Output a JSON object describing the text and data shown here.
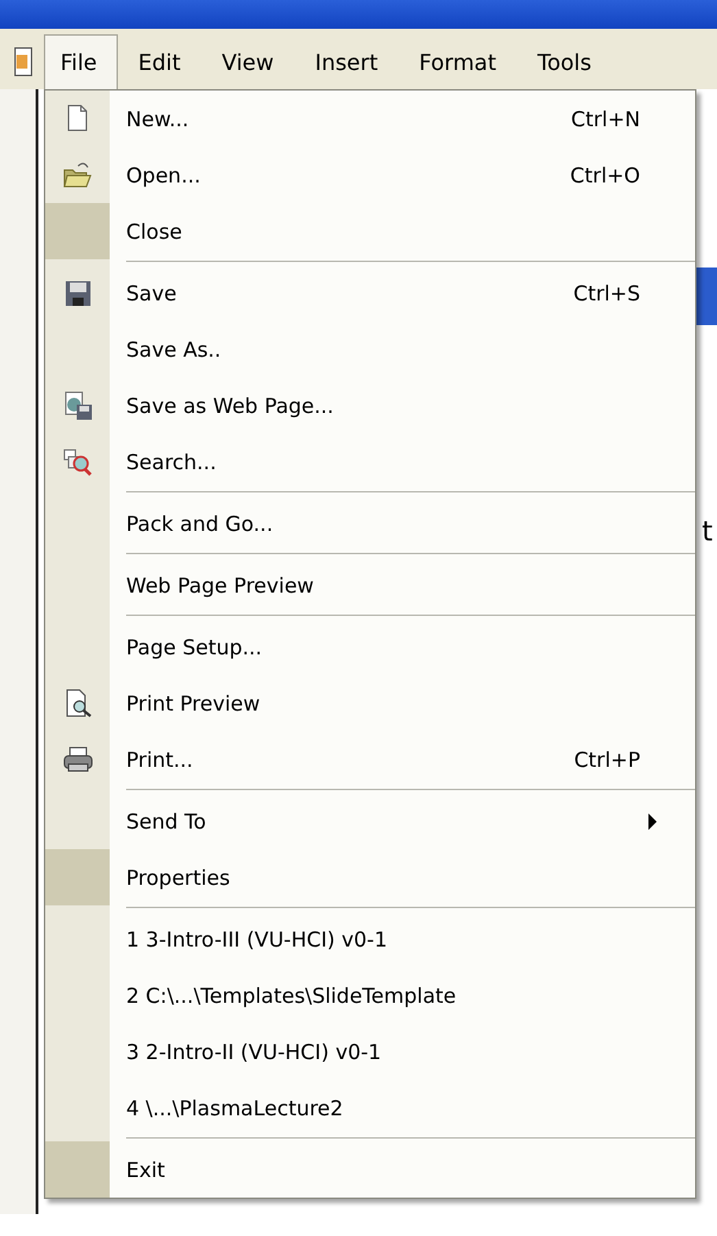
{
  "menubar": [
    {
      "label": "File",
      "selected": true
    },
    {
      "label": "Edit",
      "selected": false
    },
    {
      "label": "View",
      "selected": false
    },
    {
      "label": "Insert",
      "selected": false
    },
    {
      "label": "Format",
      "selected": false
    },
    {
      "label": "Tools",
      "selected": false
    }
  ],
  "file_menu": [
    {
      "kind": "command",
      "label": "New...",
      "shortcut": "Ctrl+N",
      "rarely_used": false
    },
    {
      "kind": "command",
      "label": "Open...",
      "shortcut": "Ctrl+O",
      "rarely_used": false
    },
    {
      "kind": "command",
      "label": "Close",
      "rarely_used": true
    },
    {
      "kind": "separator"
    },
    {
      "kind": "command",
      "label": "Save",
      "shortcut": "Ctrl+S",
      "rarely_used": false
    },
    {
      "kind": "command",
      "label": "Save As..",
      "rarely_used": false
    },
    {
      "kind": "command",
      "label": "Save as Web Page...",
      "rarely_used": false
    },
    {
      "kind": "command",
      "label": "Search...",
      "rarely_used": false
    },
    {
      "kind": "separator"
    },
    {
      "kind": "command",
      "label": "Pack and Go...",
      "rarely_used": false
    },
    {
      "kind": "separator"
    },
    {
      "kind": "command",
      "label": "Web Page Preview",
      "rarely_used": false
    },
    {
      "kind": "separator"
    },
    {
      "kind": "command",
      "label": "Page Setup...",
      "rarely_used": false
    },
    {
      "kind": "command",
      "label": "Print Preview",
      "rarely_used": false
    },
    {
      "kind": "command",
      "label": "Print...",
      "shortcut": "Ctrl+P",
      "rarely_used": false
    },
    {
      "kind": "separator"
    },
    {
      "kind": "submenu",
      "label": "Send To",
      "rarely_used": false
    },
    {
      "kind": "command",
      "label": "Properties",
      "rarely_used": true
    },
    {
      "kind": "separator"
    },
    {
      "kind": "command",
      "label": "1 3-Intro-III (VU-HCI) v0-1",
      "rarely_used": false
    },
    {
      "kind": "command",
      "label": "2 C:\\...\\Templates\\SlideTemplate",
      "rarely_used": false
    },
    {
      "kind": "command",
      "label": "3 2-Intro-II (VU-HCI) v0-1",
      "rarely_used": false
    },
    {
      "kind": "command",
      "label": "4 \\...\\PlasmaLecture2",
      "rarely_used": false
    },
    {
      "kind": "separator"
    },
    {
      "kind": "command",
      "label": "Exit",
      "rarely_used": true
    }
  ],
  "document_text_fragment": "t"
}
